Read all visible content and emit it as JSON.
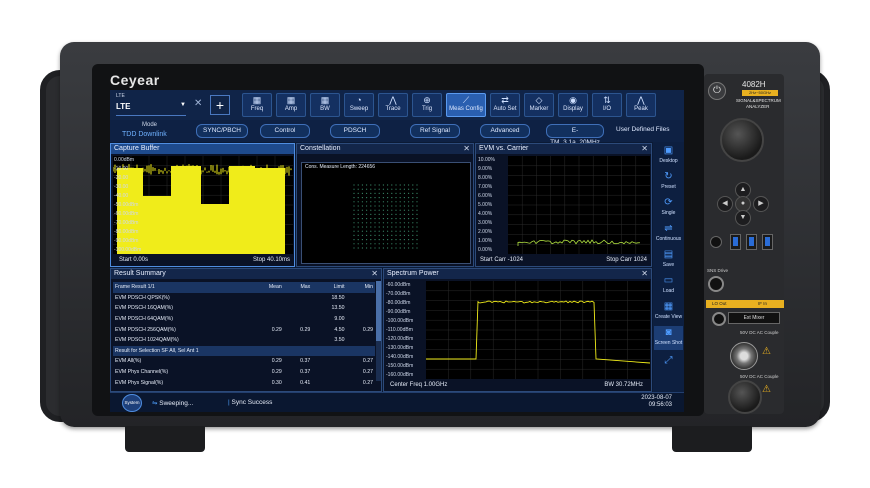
{
  "brand": {
    "logo": "Ceyear",
    "model": "4082H",
    "freq_range": "2Hz~50GHz",
    "product_line1": "SIGNAL&SPECTRUM",
    "product_line2": "ANALYZER"
  },
  "toolbar": {
    "app": "LTE",
    "app_value": "LTE",
    "buttons": [
      {
        "label": "Freq",
        "icon": "freq-icon"
      },
      {
        "label": "Amp",
        "icon": "amp-icon"
      },
      {
        "label": "BW",
        "icon": "bw-icon"
      },
      {
        "label": "Sweep",
        "icon": "sweep-icon"
      },
      {
        "label": "Trace",
        "icon": "trace-icon"
      },
      {
        "label": "Trig",
        "icon": "trig-icon"
      },
      {
        "label": "Meas Config",
        "icon": "meas-config-icon"
      },
      {
        "label": "Auto Set",
        "icon": "auto-set-icon"
      },
      {
        "label": "Marker",
        "icon": "marker-icon"
      },
      {
        "label": "Display",
        "icon": "display-icon"
      },
      {
        "label": "I/O",
        "icon": "io-icon"
      },
      {
        "label": "Peak",
        "icon": "peak-icon"
      }
    ]
  },
  "modebar": {
    "mode_label": "Mode",
    "mode_value": "TDD Downlink",
    "buttons": [
      "SYNC/PBCH",
      "Control",
      "PDSCH",
      "Ref Signal",
      "Advanced",
      "E-TM_3.1a_20MHz",
      "User Defined Files"
    ]
  },
  "capture": {
    "title": "Capture Buffer",
    "y_labels": [
      "0.00dBm",
      "-10.00",
      "-20.00",
      "-30.00",
      "-40.00",
      "-50.00dBm",
      "-60.00dBm",
      "-70.00dBm",
      "-80.00dBm",
      "-90.00dBm",
      "-100.00dBm"
    ],
    "start": "Start 0.00s",
    "stop": "Stop 40.10ms"
  },
  "constellation": {
    "title": "Constellation",
    "note": "Cons. Measure Length: 224656"
  },
  "evm_carrier": {
    "title": "EVM vs. Carrier",
    "y_labels": [
      "10.00%",
      "9.00%",
      "8.00%",
      "7.00%",
      "6.00%",
      "5.00%",
      "4.00%",
      "3.00%",
      "2.00%",
      "1.00%",
      "0.00%"
    ],
    "start": "Start Carr  -1024",
    "stop": "Stop Carr  1024"
  },
  "result_summary": {
    "title": "Result Summary",
    "header": [
      "Frame Result 1/1",
      "Mean",
      "Max",
      "Limit",
      "Min"
    ],
    "rows": [
      [
        "EVM PDSCH QPSK(%)",
        "",
        "",
        "18.50",
        ""
      ],
      [
        "EVM PDSCH 16QAM(%)",
        "",
        "",
        "13.50",
        ""
      ],
      [
        "EVM PDSCH 64QAM(%)",
        "",
        "",
        "9.00",
        ""
      ],
      [
        "EVM PDSCH 256QAM(%)",
        "0.29",
        "0.29",
        "4.50",
        "0.29"
      ],
      [
        "EVM PDSCH 1024QAM(%)",
        "",
        "",
        "3.50",
        ""
      ]
    ],
    "section": "Result for Selection SF All, Sel Ant 1",
    "rows2": [
      [
        "EVM All(%)",
        "0.29",
        "0.37",
        "",
        "0.27"
      ],
      [
        "EVM Phys Channel(%)",
        "0.29",
        "0.37",
        "",
        "0.27"
      ],
      [
        "EVM Phys Signal(%)",
        "0.30",
        "0.41",
        "",
        "0.27"
      ]
    ]
  },
  "spectrum": {
    "title": "Spectrum Power",
    "y_labels": [
      "-60.00dBm",
      "-70.00dBm",
      "-80.00dBm",
      "-90.00dBm",
      "-100.00dBm",
      "-110.00dBm",
      "-120.00dBm",
      "-130.00dBm",
      "-140.00dBm",
      "-150.00dBm",
      "-160.00dBm"
    ],
    "center": "Center Freq 1.00GHz",
    "bw": "BW 30.72MHz"
  },
  "right_strip": [
    "Desktop",
    "Preset",
    "Single",
    "Continuous",
    "Save",
    "Load",
    "Create View",
    "Screen Shot",
    ""
  ],
  "status": {
    "system": "System",
    "sweep": "Sweeping...",
    "sync": "Sync Success",
    "date": "2023-08-07",
    "time": "09:56:03"
  },
  "panel": {
    "sns": "SNS Drive",
    "lo": "LO Out",
    "if": "IF In",
    "ext": "Ext Mixer",
    "rf2": "50V DC AC Couple",
    "rf1": "50V DC AC Couple"
  }
}
